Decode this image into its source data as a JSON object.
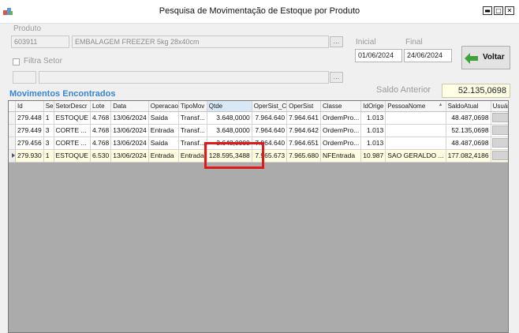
{
  "window": {
    "title": "Pesquisa de Movimentação de Estoque por Produto",
    "controls": {
      "minimize": "▬",
      "maximize": "□",
      "close": "✕"
    }
  },
  "produto": {
    "label": "Produto",
    "code": "603911",
    "description": "EMBALAGEM FREEZER 5kg 28x40cm",
    "lookup_label": "..."
  },
  "filtro": {
    "label": "Filtra Setor",
    "checked": false,
    "code": "",
    "description": "",
    "lookup_label": "..."
  },
  "period": {
    "inicial_label": "Inicial",
    "inicial_value": "01/06/2024",
    "final_label": "Final",
    "final_value": "24/06/2024"
  },
  "voltar": {
    "label": "Voltar",
    "icon": "back-arrow-icon"
  },
  "saldo_anterior": {
    "label": "Saldo Anterior",
    "value": "52.135,0698"
  },
  "section_title": "Movimentos Encontrados",
  "grid": {
    "columns": [
      "Id",
      "Se",
      "SetorDescr",
      "Lote",
      "Data",
      "Operacao",
      "TipoMov",
      "Qtde",
      "OperSist_C",
      "OperSist",
      "Classe",
      "IdOrige",
      "PessoaNome",
      "SaldoAtual",
      "Usuário"
    ],
    "sorted_column": "Qtde",
    "rows": [
      {
        "id": "279.448",
        "se": "1",
        "setor": "ESTOQUE",
        "lote": "4.768",
        "data": "13/06/2024",
        "operacao": "Saída",
        "tipomov": "Transf...",
        "qtde": "3.648,0000",
        "opersist_c": "7.964.640",
        "opersist": "7.964.641",
        "classe": "OrdemPro...",
        "idorige": "1.013",
        "pessoa": "",
        "saldo": "48.487,0698",
        "usuario": ""
      },
      {
        "id": "279.449",
        "se": "3",
        "setor": "CORTE ...",
        "lote": "4.768",
        "data": "13/06/2024",
        "operacao": "Entrada",
        "tipomov": "Transf...",
        "qtde": "3.648,0000",
        "opersist_c": "7.964.640",
        "opersist": "7.964.642",
        "classe": "OrdemPro...",
        "idorige": "1.013",
        "pessoa": "",
        "saldo": "52.135,0698",
        "usuario": ""
      },
      {
        "id": "279.456",
        "se": "3",
        "setor": "CORTE ...",
        "lote": "4.768",
        "data": "13/06/2024",
        "operacao": "Saída",
        "tipomov": "Transf...",
        "qtde": "3.648,0000",
        "opersist_c": "7.964.640",
        "opersist": "7.964.651",
        "classe": "OrdemPro...",
        "idorige": "1.013",
        "pessoa": "",
        "saldo": "48.487,0698",
        "usuario": ""
      },
      {
        "id": "279.930",
        "se": "1",
        "setor": "ESTOQUE",
        "lote": "6.530",
        "data": "13/06/2024",
        "operacao": "Entrada",
        "tipomov": "Entrada",
        "qtde": "128.595,3488",
        "opersist_c": "7.965.673",
        "opersist": "7.965.680",
        "classe": "NFEntrada",
        "idorige": "10.987",
        "pessoa": "SAO GERALDO ...",
        "saldo": "177.082,4186",
        "usuario": "",
        "current": true
      }
    ]
  },
  "colors": {
    "section_title": "#3a86d6",
    "highlight_border": "#e0191b",
    "voltar_arrow": "#3fa33a",
    "saldo_background": "#ffffe6"
  }
}
